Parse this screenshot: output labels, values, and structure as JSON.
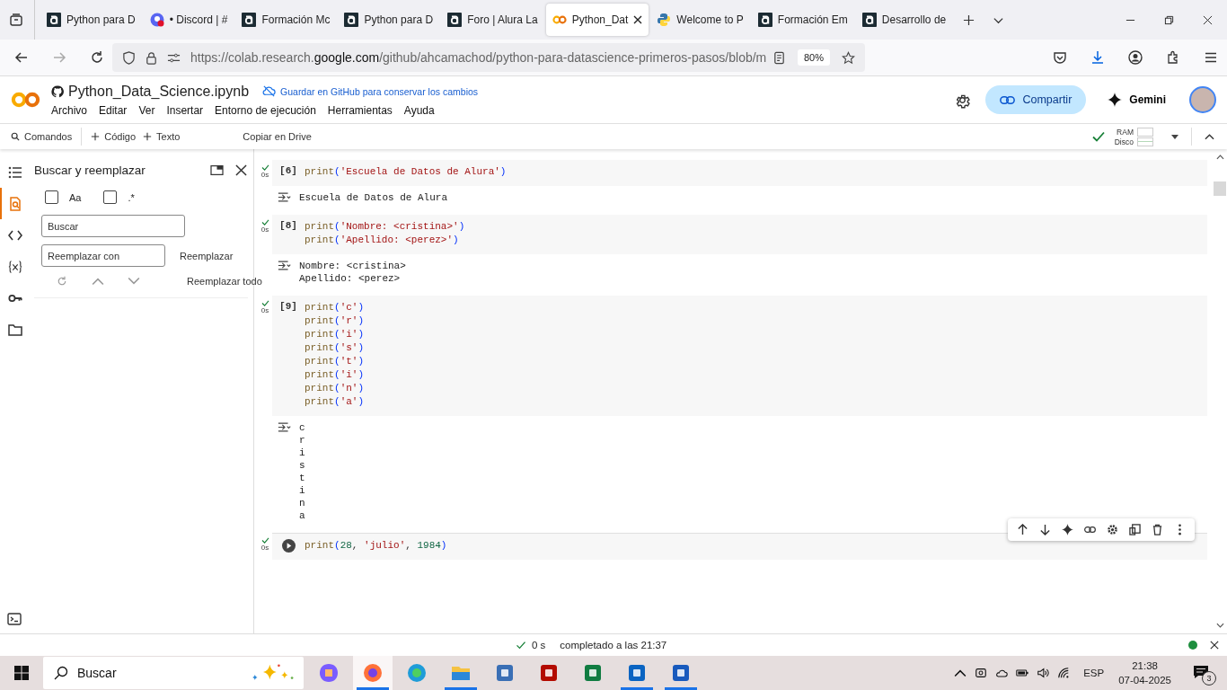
{
  "browser": {
    "tabs": [
      {
        "kind": "alura",
        "label": "Python para D",
        "selected": false
      },
      {
        "kind": "discord",
        "label": "• Discord | #",
        "selected": false
      },
      {
        "kind": "alura",
        "label": "Formación Mc",
        "selected": false
      },
      {
        "kind": "alura",
        "label": "Python para D",
        "selected": false
      },
      {
        "kind": "alura",
        "label": "Foro | Alura La",
        "selected": false
      },
      {
        "kind": "colab",
        "label": "Python_Dat",
        "selected": true
      },
      {
        "kind": "python",
        "label": "Welcome to P",
        "selected": false
      },
      {
        "kind": "alura",
        "label": "Formación Em",
        "selected": false
      },
      {
        "kind": "alura",
        "label": "Desarrollo de",
        "selected": false
      }
    ],
    "url_start": "https://colab.research.",
    "url_domain": "google.com",
    "url_rest": "/github/ahcamachod/python-para-datascience-primeros-pasos/blob/m",
    "zoom": "80%"
  },
  "notebook": {
    "title": "Python_Data_Science.ipynb",
    "save_notice": "Guardar en GitHub para conservar los cambios",
    "menu": [
      "Archivo",
      "Editar",
      "Ver",
      "Insertar",
      "Entorno de ejecución",
      "Herramientas",
      "Ayuda"
    ],
    "share_button": "Compartir",
    "gemini_button": "Gemini"
  },
  "toolbar": {
    "commands": "Comandos",
    "add_code": "Código",
    "add_text": "Texto",
    "copy_drive": "Copiar en Drive",
    "connected": true,
    "ram_label": "RAM",
    "disk_label": "Disco"
  },
  "sidebar_icons": [
    {
      "kind": "toc",
      "selected": false
    },
    {
      "kind": "find",
      "selected": true
    },
    {
      "kind": "code",
      "selected": false
    },
    {
      "kind": "variables",
      "selected": false
    },
    {
      "kind": "key",
      "selected": false
    },
    {
      "kind": "folder",
      "selected": false
    }
  ],
  "find_panel": {
    "title": "Buscar y reemplazar",
    "options": [
      {
        "label": "Aa",
        "checked": false
      },
      {
        "label": ".*",
        "checked": false
      }
    ],
    "find_placeholder": "Buscar",
    "replace_placeholder": "Reemplazar con",
    "replace_button": "Reemplazar",
    "replace_all_button": "Reemplazar todo"
  },
  "cells": [
    {
      "count": "[6]",
      "done": true,
      "time": "0s",
      "focused": false,
      "code": [
        "print('Escuela de Datos de Alura')"
      ],
      "output": [
        "Escuela de Datos de Alura"
      ]
    },
    {
      "count": "[8]",
      "done": true,
      "time": "0s",
      "focused": false,
      "code": [
        "print('Nombre: <cristina>')",
        "print('Apellido: <perez>')"
      ],
      "output": [
        "Nombre: <cristina>",
        "Apellido: <perez>"
      ]
    },
    {
      "count": "[9]",
      "done": true,
      "time": "0s",
      "focused": false,
      "code": [
        "print('c')",
        "print('r')",
        "print('i')",
        "print('s')",
        "print('t')",
        "print('i')",
        "print('n')",
        "print('a')"
      ],
      "output": [
        "c",
        "r",
        "i",
        "s",
        "t",
        "i",
        "n",
        "a"
      ]
    },
    {
      "done": true,
      "time": "0s",
      "focused": true,
      "code": [
        "print(28, 'julio', 1984)"
      ]
    }
  ],
  "status_bar": {
    "done": true,
    "duration": "0 s",
    "message": "completado a las 21:37",
    "connected": true
  },
  "taskbar": {
    "search_placeholder": "Buscar",
    "apps": [
      {
        "kind": "copilot",
        "running": false,
        "selected": false
      },
      {
        "kind": "firefox",
        "running": true,
        "selected": true
      },
      {
        "kind": "edge",
        "running": false,
        "selected": false
      },
      {
        "kind": "explorer",
        "running": true,
        "selected": false
      },
      {
        "kind": "remote",
        "running": false,
        "selected": false
      },
      {
        "kind": "acrobat",
        "running": false,
        "selected": false
      },
      {
        "kind": "excel",
        "running": false,
        "selected": false
      },
      {
        "kind": "outlook",
        "running": true,
        "selected": false
      },
      {
        "kind": "word",
        "running": true,
        "selected": false
      }
    ],
    "language": "ESP",
    "time": "21:38",
    "date": "07-04-2025",
    "notifications": "3"
  }
}
